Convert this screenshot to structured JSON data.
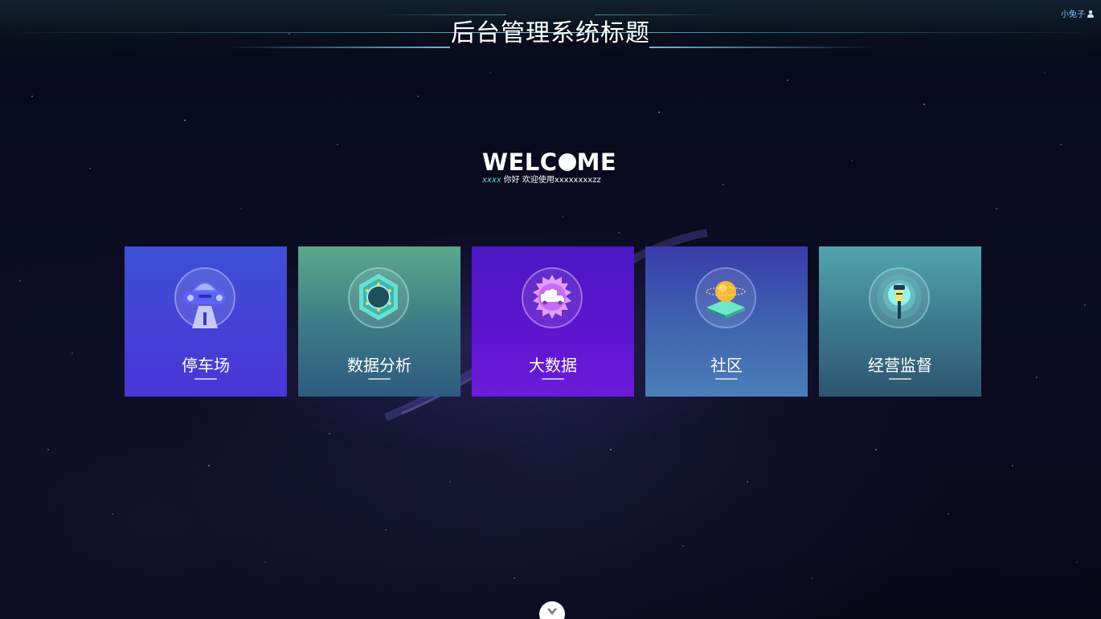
{
  "header": {
    "title": "后台管理系统标题",
    "user_name": "小兔子",
    "user_icon": "user-icon"
  },
  "welcome": {
    "title_left": "WELC",
    "title_right": "ME",
    "username": "xxxx",
    "greeting": "你好 欢迎使用xxxxxxxxzz"
  },
  "cards": [
    {
      "label": "停车场",
      "icon": "car-icon"
    },
    {
      "label": "数据分析",
      "icon": "hexagon-chart-icon"
    },
    {
      "label": "大数据",
      "icon": "truck-badge-icon"
    },
    {
      "label": "社区",
      "icon": "globe-platform-icon"
    },
    {
      "label": "经营监督",
      "icon": "lamp-icon"
    }
  ],
  "scroll_button_icon": "chevron-down-icon",
  "colors": {
    "title_accent_line": "#8ce6f0",
    "user_menu": "#7fc2ff",
    "welcome_username": "#5ed0e8"
  }
}
